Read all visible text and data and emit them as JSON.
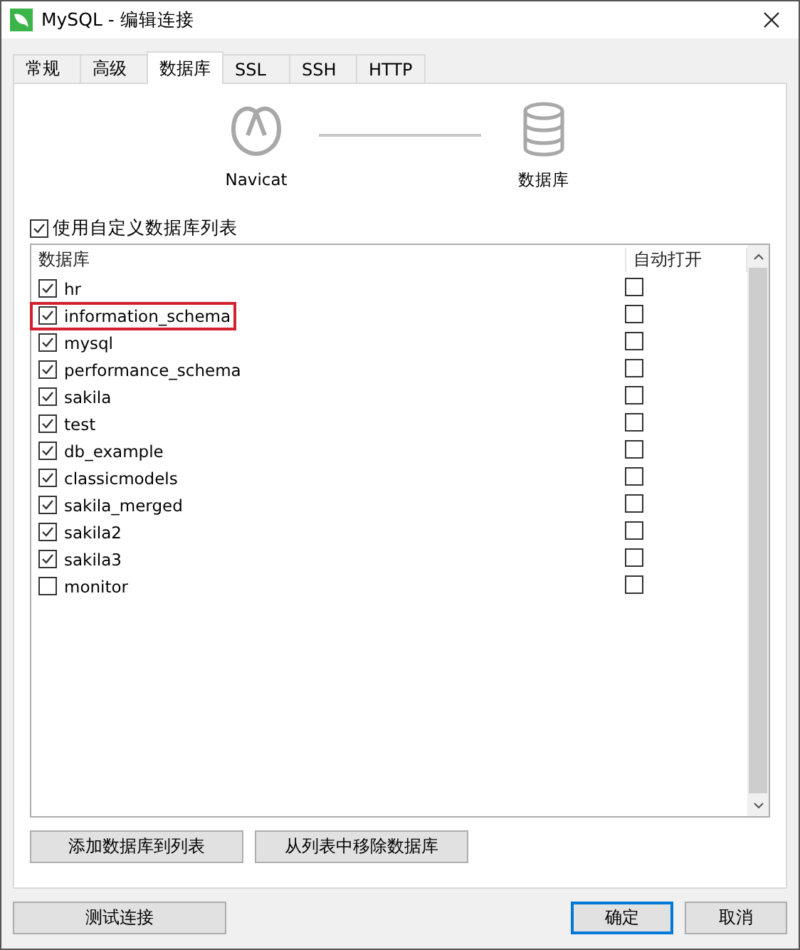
{
  "window": {
    "title": "MySQL - 编辑连接"
  },
  "tabs": [
    {
      "label": "常规",
      "selected": false
    },
    {
      "label": "高级",
      "selected": false
    },
    {
      "label": "数据库",
      "selected": true
    },
    {
      "label": "SSL",
      "selected": false
    },
    {
      "label": "SSH",
      "selected": false
    },
    {
      "label": "HTTP",
      "selected": false
    }
  ],
  "diagram": {
    "source_label": "Navicat",
    "target_label": "数据库"
  },
  "custom_list": {
    "label": "使用自定义数据库列表",
    "checked": true
  },
  "table": {
    "columns": [
      "数据库",
      "自动打开"
    ],
    "rows": [
      {
        "name": "hr",
        "checked": true,
        "auto_open": false,
        "highlighted": false
      },
      {
        "name": "information_schema",
        "checked": true,
        "auto_open": false,
        "highlighted": true
      },
      {
        "name": "mysql",
        "checked": true,
        "auto_open": false,
        "highlighted": false
      },
      {
        "name": "performance_schema",
        "checked": true,
        "auto_open": false,
        "highlighted": false
      },
      {
        "name": "sakila",
        "checked": true,
        "auto_open": false,
        "highlighted": false
      },
      {
        "name": "test",
        "checked": true,
        "auto_open": false,
        "highlighted": false
      },
      {
        "name": "db_example",
        "checked": true,
        "auto_open": false,
        "highlighted": false
      },
      {
        "name": "classicmodels",
        "checked": true,
        "auto_open": false,
        "highlighted": false
      },
      {
        "name": "sakila_merged",
        "checked": true,
        "auto_open": false,
        "highlighted": false
      },
      {
        "name": "sakila2",
        "checked": true,
        "auto_open": false,
        "highlighted": false
      },
      {
        "name": "sakila3",
        "checked": true,
        "auto_open": false,
        "highlighted": false
      },
      {
        "name": "monitor",
        "checked": false,
        "auto_open": false,
        "highlighted": false
      }
    ]
  },
  "list_buttons": [
    "添加数据库到列表",
    "从列表中移除数据库"
  ],
  "footer": {
    "test_button": "测试连接",
    "buttons": [
      {
        "label": "确定",
        "selected": true
      },
      {
        "label": "取消",
        "selected": false
      }
    ]
  }
}
